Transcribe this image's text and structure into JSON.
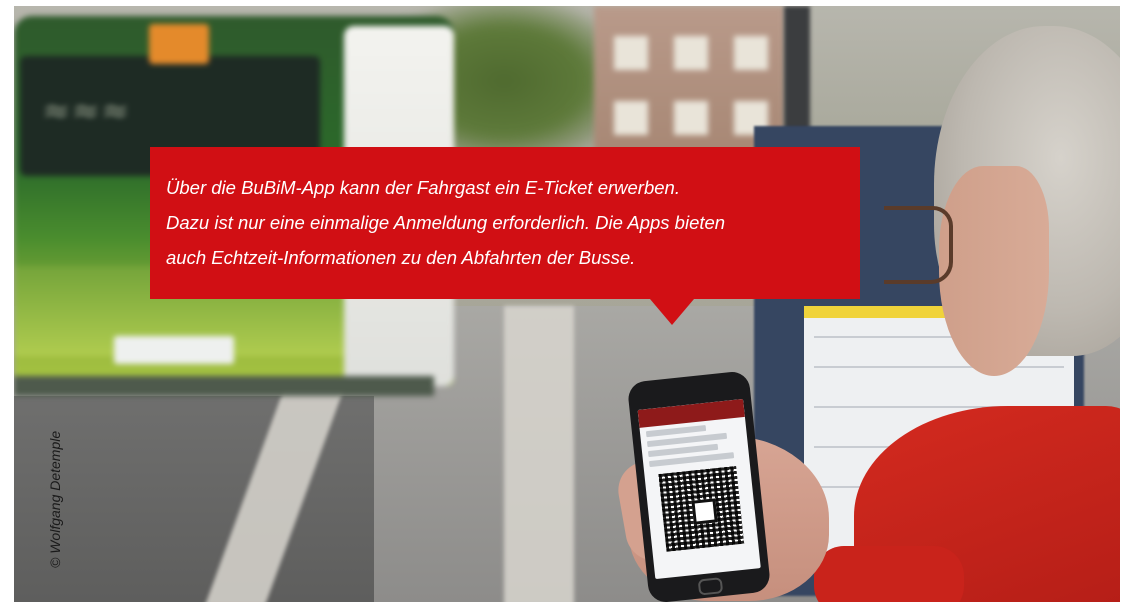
{
  "photo": {
    "description_free": true,
    "callout": {
      "lines": [
        "Über die BuBiM-App kann der Fahrgast ein E-Ticket erwerben.",
        "Dazu ist nur eine einmalige Anmeldung erforderlich. Die Apps bieten",
        "auch Echtzeit-Informationen zu den Abfahrten der Busse."
      ],
      "background_color": "#d10f14",
      "text_color": "#ffffff"
    },
    "credit": "© Wolfgang Detemple"
  }
}
